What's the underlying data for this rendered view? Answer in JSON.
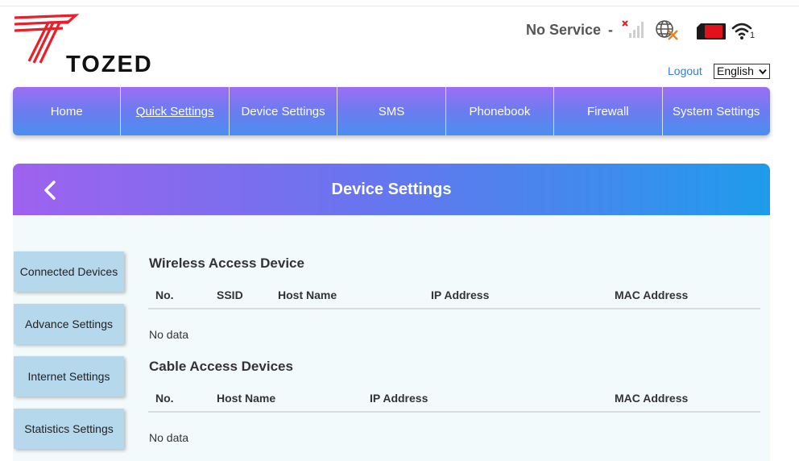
{
  "brand": {
    "name": "TOZED"
  },
  "status": {
    "network_text": "No Service",
    "separator": "-",
    "signal_icon": "signal-no-service-icon",
    "internet_icon": "globe-disconnected-icon",
    "sim_icon": "sim-card-icon",
    "wifi_icon": "wifi-icon",
    "wifi_clients": "1"
  },
  "header": {
    "logout_label": "Logout",
    "language": "English"
  },
  "nav": {
    "items": [
      {
        "label": "Home"
      },
      {
        "label": "Quick Settings"
      },
      {
        "label": "Device Settings"
      },
      {
        "label": "SMS"
      },
      {
        "label": "Phonebook"
      },
      {
        "label": "Firewall"
      },
      {
        "label": "System Settings"
      }
    ]
  },
  "panel": {
    "title": "Device Settings"
  },
  "sidebar": {
    "items": [
      {
        "label": "Connected Devices"
      },
      {
        "label": "Advance Settings"
      },
      {
        "label": "Internet Settings"
      },
      {
        "label": "Statistics Settings"
      }
    ]
  },
  "wireless": {
    "title": "Wireless Access Device",
    "columns": [
      "No.",
      "SSID",
      "Host Name",
      "IP Address",
      "MAC Address"
    ],
    "empty_text": "No data"
  },
  "cable": {
    "title": "Cable Access Devices",
    "columns": [
      "No.",
      "Host Name",
      "IP Address",
      "MAC Address"
    ],
    "empty_text": "No data"
  },
  "colors": {
    "nav_gradient_start": "#9b6ff4",
    "nav_gradient_end": "#4a8ff0",
    "header_gradient_start": "#9e62ef",
    "header_gradient_end": "#1e9cec",
    "sidebar_button": "#b5d8ec",
    "logo_red": "#e8202a",
    "sim_red": "#e3101d",
    "link_blue": "#3a7bd5"
  }
}
